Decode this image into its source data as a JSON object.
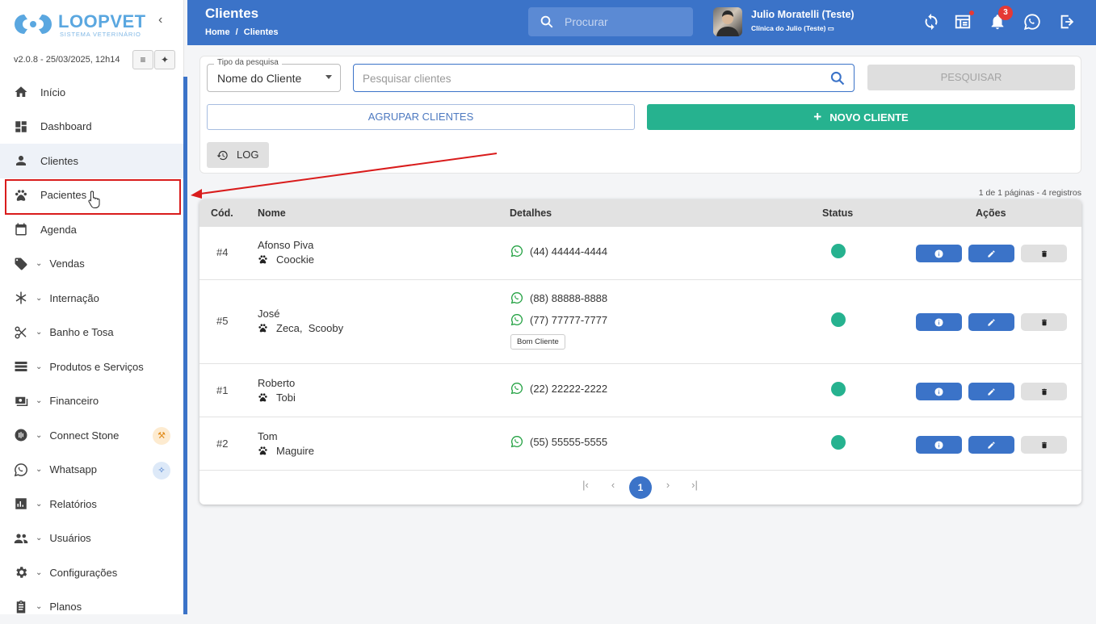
{
  "brand": {
    "name": "LOOPVET",
    "tagline": "SISTEMA VETERINÁRIO"
  },
  "version": "v2.0.8 - 25/03/2025, 12h14",
  "sidebar": {
    "items": [
      {
        "label": "Início",
        "icon": "home-icon",
        "chevron": false
      },
      {
        "label": "Dashboard",
        "icon": "dashboard-icon",
        "chevron": false
      },
      {
        "label": "Clientes",
        "icon": "person-icon",
        "chevron": false
      },
      {
        "label": "Pacientes",
        "icon": "paw-icon",
        "chevron": false
      },
      {
        "label": "Agenda",
        "icon": "calendar-icon",
        "chevron": false
      },
      {
        "label": "Vendas",
        "icon": "tag-icon",
        "chevron": true
      },
      {
        "label": "Internação",
        "icon": "asterisk-icon",
        "chevron": true
      },
      {
        "label": "Banho e Tosa",
        "icon": "scissors-icon",
        "chevron": true
      },
      {
        "label": "Produtos e Serviços",
        "icon": "list-icon",
        "chevron": true
      },
      {
        "label": "Financeiro",
        "icon": "money-icon",
        "chevron": true
      },
      {
        "label": "Connect Stone",
        "icon": "stone-icon",
        "chevron": true
      },
      {
        "label": "Whatsapp",
        "icon": "whatsapp-icon",
        "chevron": true
      },
      {
        "label": "Relatórios",
        "icon": "chart-icon",
        "chevron": true
      },
      {
        "label": "Usuários",
        "icon": "users-icon",
        "chevron": true
      },
      {
        "label": "Configurações",
        "icon": "gear-icon",
        "chevron": true
      },
      {
        "label": "Planos",
        "icon": "clipboard-icon",
        "chevron": true
      }
    ]
  },
  "header": {
    "title": "Clientes",
    "breadcrumb_home": "Home",
    "breadcrumb_sep": "/",
    "breadcrumb_current": "Clientes",
    "search_placeholder": "Procurar",
    "user_name": "Julio Moratelli (Teste)",
    "clinic": "Clínica do Julio (Teste)",
    "notifications": "3"
  },
  "filters": {
    "type_label": "Tipo da pesquisa",
    "type_value": "Nome do Cliente",
    "search_placeholder": "Pesquisar clientes",
    "search_button": "PESQUISAR",
    "group_button": "AGRUPAR CLIENTES",
    "new_button": "NOVO CLIENTE",
    "log_button": "LOG"
  },
  "pagination": {
    "info": "1 de 1 páginas - 4 registros",
    "current": "1"
  },
  "table": {
    "headers": {
      "cod": "Cód.",
      "nome": "Nome",
      "detalhes": "Detalhes",
      "status": "Status",
      "acoes": "Ações"
    },
    "rows": [
      {
        "cod": "#4",
        "name": "Afonso Piva",
        "pets": "Coockie",
        "phones": [
          "(44) 44444-4444"
        ],
        "tag": ""
      },
      {
        "cod": "#5",
        "name": "José",
        "pets": "Zeca,  Scooby",
        "phones": [
          "(88) 88888-8888",
          "(77) 77777-7777"
        ],
        "tag": "Bom Cliente"
      },
      {
        "cod": "#1",
        "name": "Roberto",
        "pets": "Tobi",
        "phones": [
          "(22) 22222-2222"
        ],
        "tag": ""
      },
      {
        "cod": "#2",
        "name": "Tom",
        "pets": "Maguire",
        "phones": [
          "(55) 55555-5555"
        ],
        "tag": ""
      }
    ]
  },
  "colors": {
    "primary": "#3b73c8",
    "success": "#26b28f",
    "highlight": "#d91c1c"
  }
}
